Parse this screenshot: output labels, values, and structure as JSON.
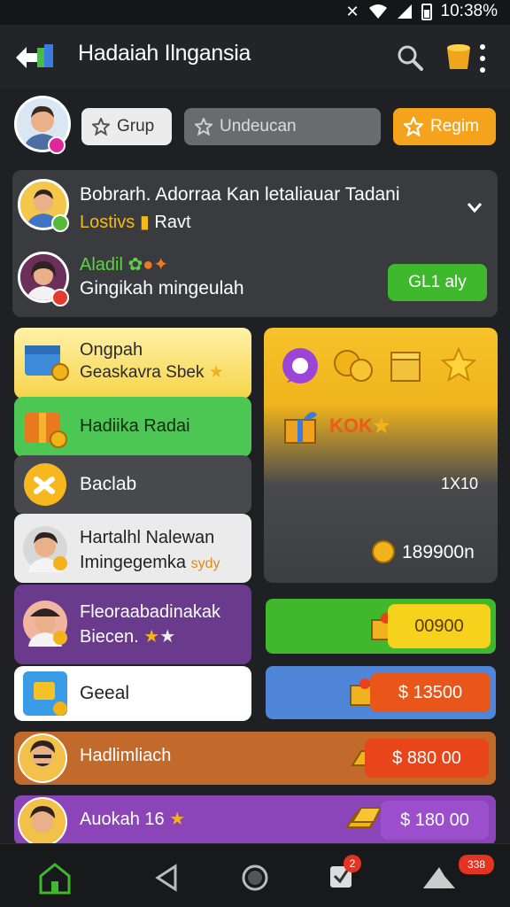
{
  "status": {
    "time": "10:38%"
  },
  "header": {
    "title": "Hadaiah Ilngansia"
  },
  "chips": [
    {
      "label": "Grup"
    },
    {
      "label": "Undeucan"
    },
    {
      "label": "Regim"
    }
  ],
  "notification": {
    "title": "Bobrarh. Adorraa Kan letaliauar Tadani",
    "sub_gold": "Lostivs",
    "sub_rest": "Ravt",
    "name": "Aladil",
    "message": "Gingikah mingeulah",
    "button": "GL1 aly"
  },
  "list": [
    {
      "line1": "Ongpah",
      "line2": "Geaskavra Sbek"
    },
    {
      "line1": "Hadiika Radai",
      "line2": ""
    },
    {
      "line1": "Baclab",
      "line2": ""
    },
    {
      "line1": "Hartalhl Nalewan",
      "line2": "Imingegemka",
      "tag": "sydy"
    },
    {
      "line1": "Fleoraabadinakak",
      "line2": "Biecen."
    },
    {
      "line1": "Geeal",
      "line2": ""
    }
  ],
  "panel": {
    "badge": "KOK",
    "count": "1X10",
    "total": "189900n"
  },
  "prices": [
    {
      "value": "00900"
    },
    {
      "value": "$ 13500"
    },
    {
      "value": "$ 880 00"
    },
    {
      "value": "$ 180 00"
    }
  ],
  "rows": [
    {
      "label": "Hadlimliach"
    },
    {
      "label": "Auokah 16"
    }
  ],
  "nav": {
    "badge1": "2",
    "badge2": "338"
  },
  "colors": {
    "accent": "#f5a31c",
    "green": "#3fb82d",
    "orange": "#e8561a",
    "purple": "#7b3fa3"
  }
}
